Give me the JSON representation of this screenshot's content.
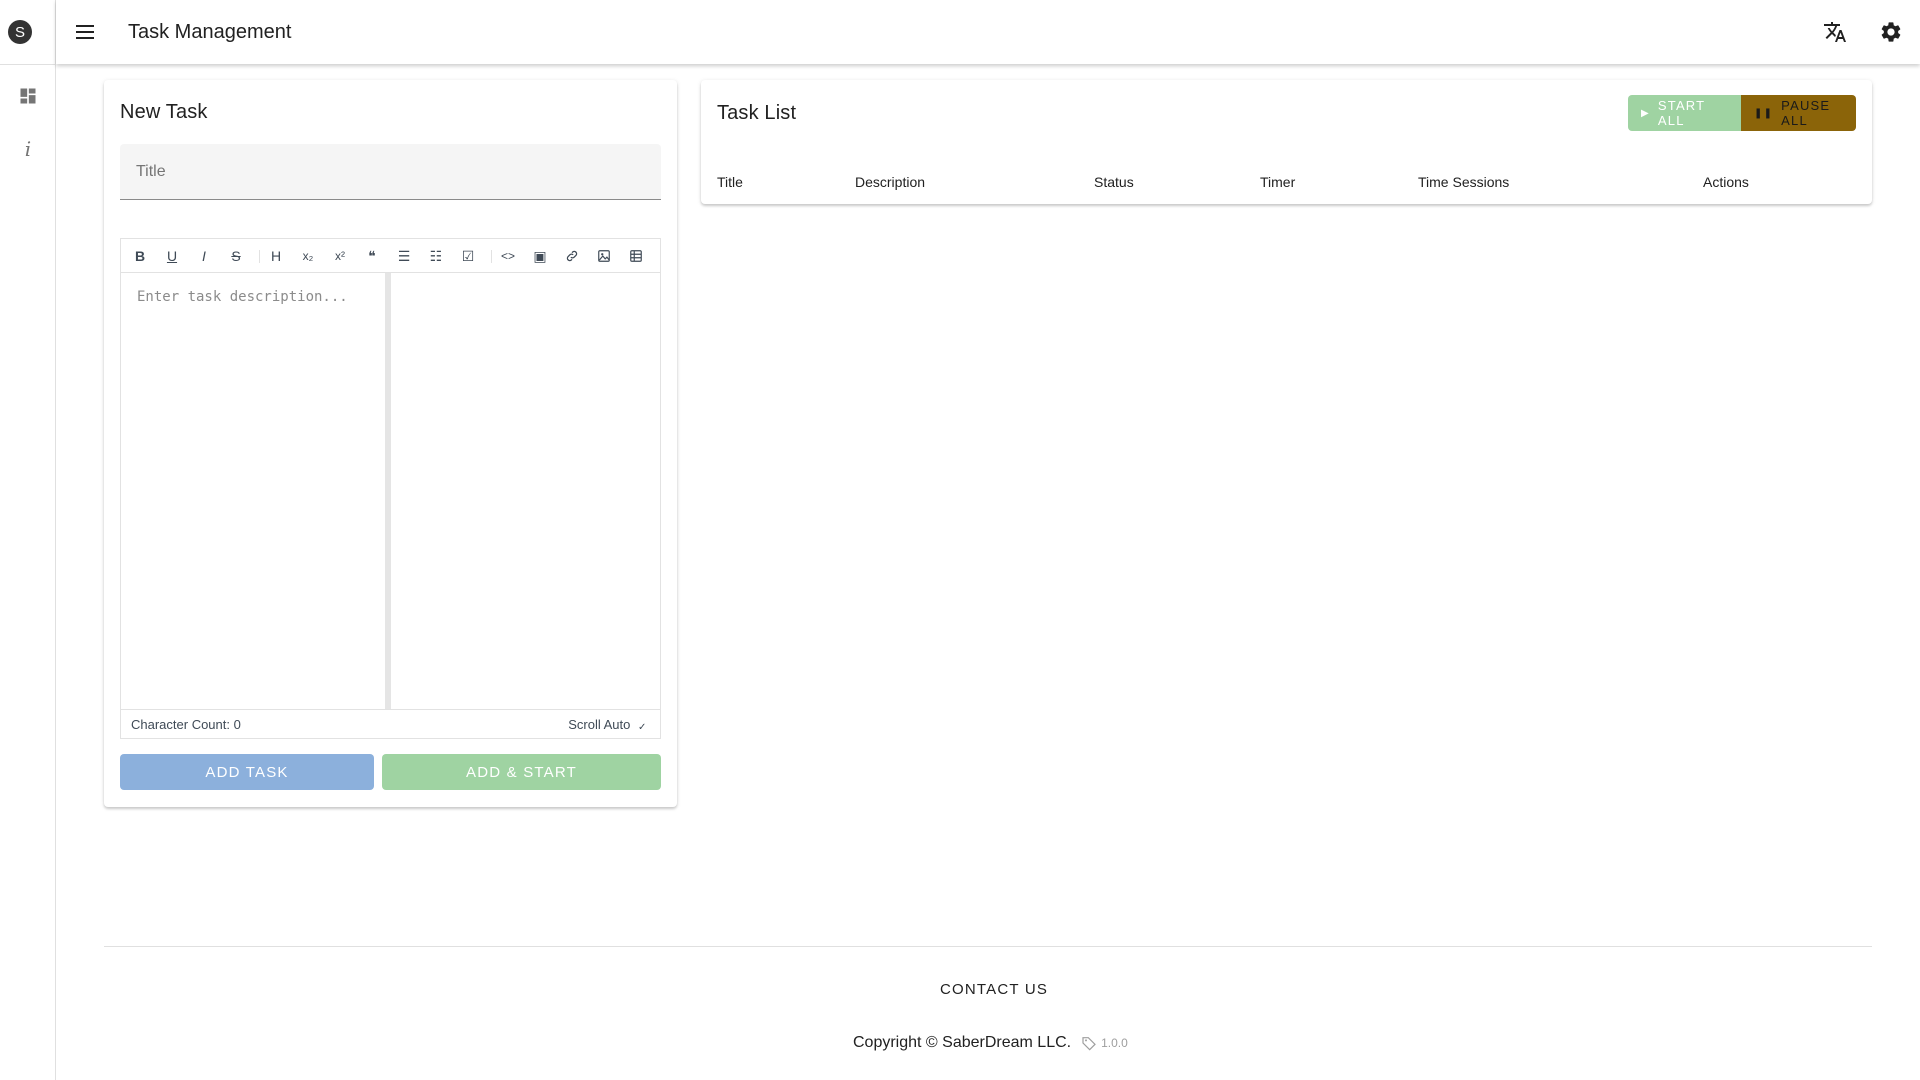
{
  "rail": {
    "logo_letter": "S",
    "items": [
      {
        "icon": "dashboard-icon"
      },
      {
        "icon": "info-icon",
        "glyph": "i"
      }
    ]
  },
  "appbar": {
    "title": "Task Management",
    "icons": [
      "menu-icon",
      "translate-icon",
      "settings-icon"
    ]
  },
  "new_task": {
    "heading": "New Task",
    "title_placeholder": "Title",
    "title_value": "",
    "toolbar": [
      {
        "name": "bold",
        "glyph": "B"
      },
      {
        "name": "underline",
        "glyph": "U"
      },
      {
        "name": "italic",
        "glyph": "I"
      },
      {
        "name": "strikethrough",
        "glyph": "S"
      },
      {
        "name": "heading",
        "glyph": "H"
      },
      {
        "name": "subscript",
        "glyph": "x₂"
      },
      {
        "name": "superscript",
        "glyph": "x²"
      },
      {
        "name": "quote",
        "glyph": "❝"
      },
      {
        "name": "unordered-list",
        "glyph": "☰"
      },
      {
        "name": "ordered-list",
        "glyph": "☷"
      },
      {
        "name": "task-list",
        "glyph": "☑"
      },
      {
        "name": "code",
        "glyph": "<>"
      },
      {
        "name": "code-block",
        "glyph": "▣"
      },
      {
        "name": "link",
        "glyph": "🔗"
      },
      {
        "name": "image",
        "glyph": "▨"
      },
      {
        "name": "table",
        "glyph": "▦"
      }
    ],
    "description_placeholder": "Enter task description...",
    "char_count_label": "Character Count:",
    "char_count_value": "0",
    "scroll_label": "Scroll Auto",
    "scroll_checked": true,
    "add_button": "Add Task",
    "add_start_button": "Add & Start"
  },
  "task_list": {
    "heading": "Task List",
    "start_all": "Start All",
    "pause_all": "Pause All",
    "columns": [
      "Title",
      "Description",
      "Status",
      "Timer",
      "Time Sessions",
      "Actions"
    ]
  },
  "footer": {
    "contact": "Contact Us",
    "copyright": "Copyright © SaberDream LLC.",
    "version": "1.0.0"
  },
  "colors": {
    "add_button": "#8cb0dc",
    "add_start_button": "#9fd3a2",
    "start_all": "#9fd3a2",
    "pause_all": "#8b6409"
  }
}
